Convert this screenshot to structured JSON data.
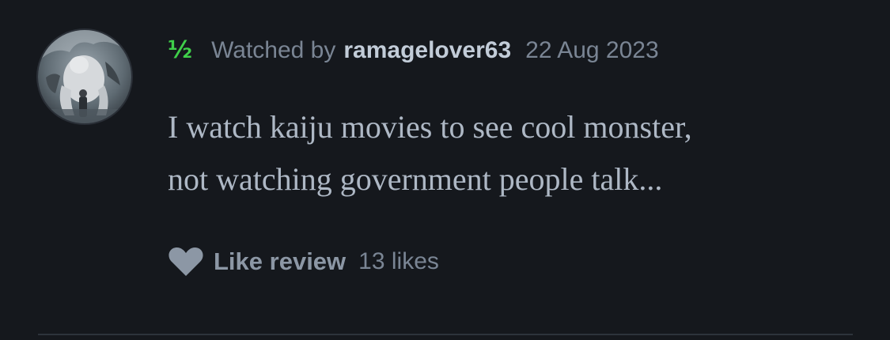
{
  "review": {
    "rating": "½",
    "watched_label": "Watched by",
    "username": "ramagelover63",
    "date": "22 Aug 2023",
    "body_lines": [
      "I watch kaiju movies to see cool monster,",
      "not watching government people talk..."
    ],
    "like_label": "Like review",
    "like_count": "13 likes"
  },
  "colors": {
    "background": "#15181d",
    "rating_green": "#3fcf4a",
    "username": "#c2ccd8",
    "muted_text": "#7a8594",
    "body_text": "#aeb8c5",
    "heart": "#8c97a5"
  },
  "icons": {
    "like": "heart-icon",
    "avatar": "avatar-image"
  }
}
